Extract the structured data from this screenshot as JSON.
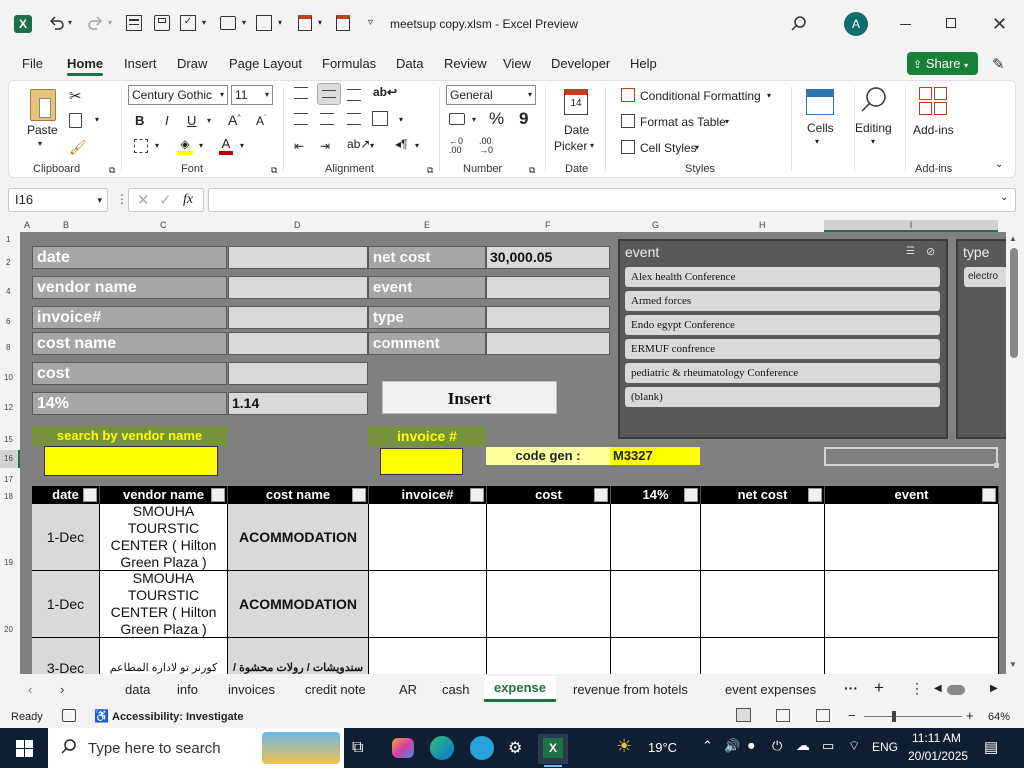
{
  "title": {
    "filename": "meetsup copy.xlsm",
    "sep": "-",
    "app": "Excel Preview",
    "avatar": "A"
  },
  "menu": {
    "items": [
      "File",
      "Home",
      "Insert",
      "Draw",
      "Page Layout",
      "Formulas",
      "Data",
      "Review",
      "View",
      "Developer",
      "Help"
    ],
    "share": "Share"
  },
  "ribbon": {
    "clipboard": {
      "paste": "Paste",
      "label": "Clipboard"
    },
    "font": {
      "name": "Century Gothic",
      "size": "11",
      "label": "Font"
    },
    "alignment": {
      "label": "Alignment"
    },
    "number": {
      "format": "General",
      "label": "Number"
    },
    "date": {
      "line1": "Date",
      "line2": "Picker",
      "label": "Date",
      "icon_day": "14"
    },
    "styles": {
      "cond": "Conditional Formatting",
      "table": "Format as Table",
      "cell": "Cell Styles",
      "label": "Styles"
    },
    "cells": {
      "label": "Cells"
    },
    "editing": {
      "label": "Editing"
    },
    "addins": {
      "btn": "Add-ins",
      "label": "Add-ins"
    }
  },
  "formula_bar": {
    "cell_ref": "I16",
    "fx": "fx",
    "content": ""
  },
  "columns": [
    "A",
    "B",
    "C",
    "D",
    "E",
    "F",
    "G",
    "H",
    "I"
  ],
  "rows": [
    "1",
    "2",
    "4",
    "6",
    "8",
    "10",
    "12",
    "15",
    "16",
    "17",
    "18",
    "19",
    "20"
  ],
  "form": {
    "date": "date",
    "vendor": "vendor name",
    "invoice": "invoice#",
    "costname": "cost name",
    "cost": "cost",
    "pct": "14%",
    "pct_val": "1.14",
    "netcost": "net cost",
    "netcost_val": "30,000.05",
    "event": "event",
    "type": "type",
    "comment": "comment",
    "insert": "Insert",
    "search_vendor": "search by vendor name",
    "invoice_no": "invoice #",
    "codegen_label": "code gen :",
    "codegen_val": "M3327"
  },
  "slicer_event": {
    "title": "event",
    "items": [
      "Alex health Conference",
      "Armed forces",
      "Endo egypt Conference",
      "ERMUF confrence",
      "pediatric & rheumatology Conference",
      "(blank)"
    ]
  },
  "slicer_type": {
    "title": "type",
    "items": [
      "electro"
    ]
  },
  "table": {
    "headers": [
      "date",
      "vendor name",
      "cost name",
      "invoice#",
      "cost",
      "14%",
      "net cost",
      "event"
    ],
    "rows": [
      {
        "date": "1-Dec",
        "vendor": "SMOUHA TOURSTIC CENTER ( Hilton Green Plaza )",
        "costname": "ACOMMODATION"
      },
      {
        "date": "1-Dec",
        "vendor": "SMOUHA TOURSTIC CENTER ( Hilton Green Plaza )",
        "costname": "ACOMMODATION"
      },
      {
        "date": "3-Dec",
        "vendor": "كورنر تو لاداره المطاعم",
        "costname": "سندويشات / رولات محشوة /"
      }
    ]
  },
  "sheet_tabs": [
    "data",
    "info",
    "invoices",
    "credit note",
    "AR",
    "cash",
    "expense",
    "revenue from hotels",
    "event expenses"
  ],
  "active_tab": "expense",
  "status": {
    "ready": "Ready",
    "accessibility": "Accessibility: Investigate",
    "zoom": "64%"
  },
  "taskbar": {
    "search": "Type here to search",
    "temp": "19°C",
    "lang": "ENG",
    "time": "11:11 AM",
    "date": "20/01/2025"
  },
  "colors": {
    "excel_green": "#1e7145",
    "share_green": "#1a7f37",
    "sheet_bg": "#808080",
    "label_grey": "#a6a6a6",
    "yellow": "#ffff00",
    "olive": "#76933c",
    "header_black": "#000000"
  }
}
